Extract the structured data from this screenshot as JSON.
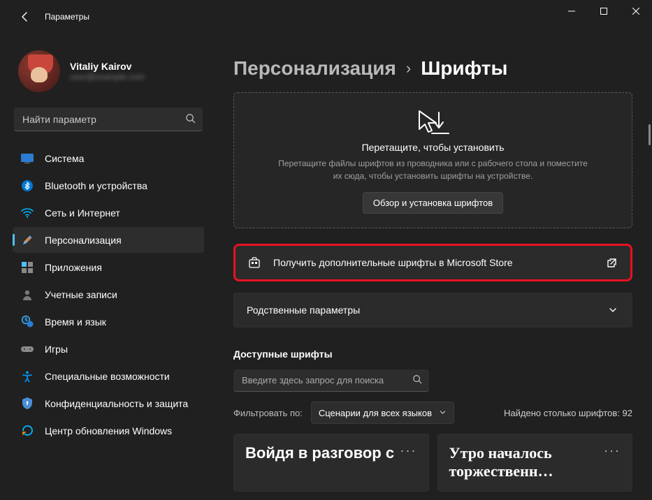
{
  "titlebar": {
    "app_name": "Параметры"
  },
  "user": {
    "name": "Vitaliy Kairov",
    "email_masked": "user@example.com"
  },
  "search": {
    "placeholder": "Найти параметр"
  },
  "nav": {
    "items": [
      {
        "id": "system",
        "label": "Система"
      },
      {
        "id": "bluetooth",
        "label": "Bluetooth и устройства"
      },
      {
        "id": "network",
        "label": "Сеть и Интернет"
      },
      {
        "id": "personalization",
        "label": "Персонализация",
        "selected": true
      },
      {
        "id": "apps",
        "label": "Приложения"
      },
      {
        "id": "accounts",
        "label": "Учетные записи"
      },
      {
        "id": "time",
        "label": "Время и язык"
      },
      {
        "id": "games",
        "label": "Игры"
      },
      {
        "id": "accessibility",
        "label": "Специальные возможности"
      },
      {
        "id": "privacy",
        "label": "Конфиденциальность и защита"
      },
      {
        "id": "update",
        "label": "Центр обновления Windows"
      }
    ]
  },
  "breadcrumb": {
    "parent": "Персонализация",
    "current": "Шрифты"
  },
  "dropzone": {
    "title": "Перетащите, чтобы установить",
    "subtitle": "Перетащите файлы шрифтов из проводника или с рабочего стола и поместите их сюда, чтобы установить шрифты на устройстве.",
    "button": "Обзор и установка шрифтов"
  },
  "store_card": {
    "label": "Получить дополнительные шрифты в Microsoft Store"
  },
  "related_card": {
    "label": "Родственные параметры"
  },
  "available": {
    "section_title": "Доступные шрифты",
    "search_placeholder": "Введите здесь запрос для поиска",
    "filter_label": "Фильтровать по:",
    "filter_value": "Сценарии для всех языков",
    "count_label": "Найдено столько шрифтов: 92"
  },
  "font_cards": [
    {
      "sample": "Войдя в разговор с"
    },
    {
      "sample": "Утро началось торжественн…"
    }
  ]
}
